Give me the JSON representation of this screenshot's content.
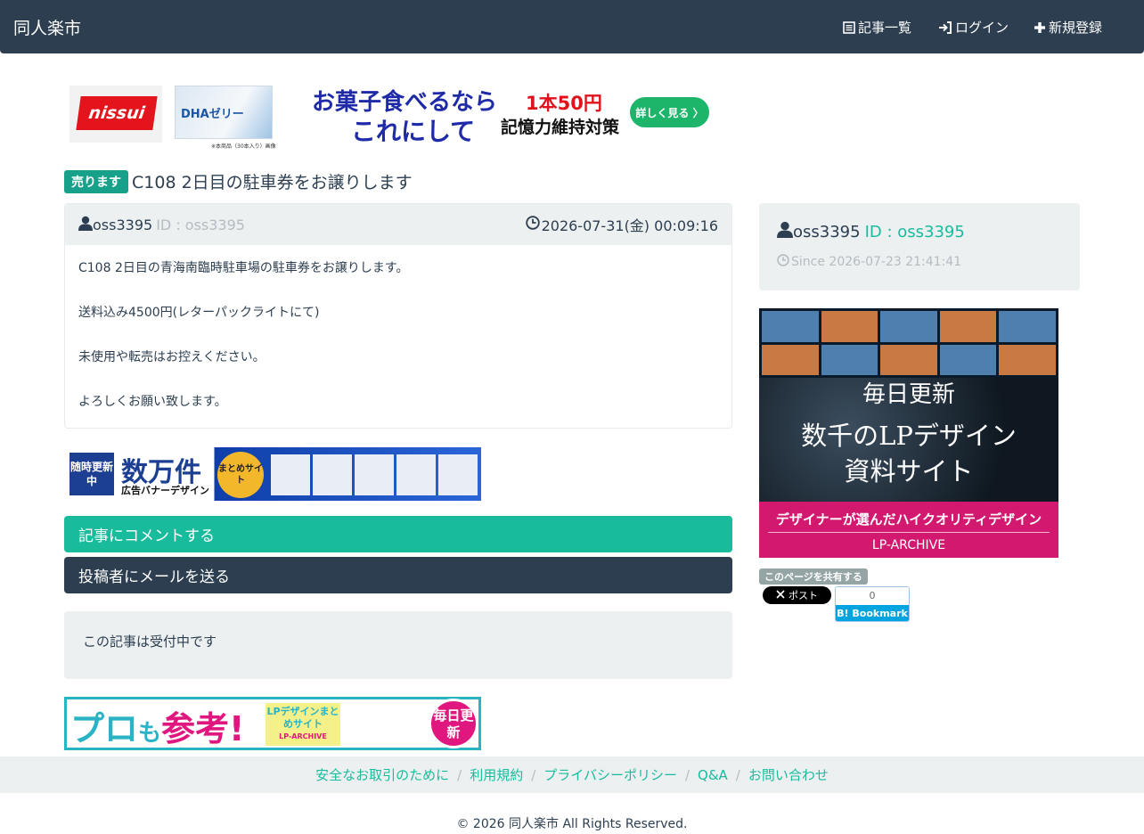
{
  "navbar": {
    "brand": "同人楽市",
    "items": [
      {
        "label": "記事一覧",
        "icon": "list-icon"
      },
      {
        "label": "ログイン",
        "icon": "login-icon"
      },
      {
        "label": "新規登録",
        "icon": "plus-icon"
      }
    ]
  },
  "ad_top": {
    "brand": "nissui",
    "product": "DHAゼリー",
    "note": "※本商品（30本入り）画像",
    "copy1": "お菓子食べるなら",
    "copy2": "これにして",
    "price": "1本50円",
    "sub": "記憶力維持対策",
    "button": "詳しく見る 〉"
  },
  "post": {
    "badge": "売ります",
    "title": "C108 2日目の駐車券をお譲りします",
    "author": "oss3395",
    "author_id": "ID : oss3395",
    "date": "2026-07-31(金) 00:09:16",
    "body": [
      "C108 2日目の青海南臨時駐車場の駐車券をお譲りします。",
      "送料込み4500円(レターパックライトにて)",
      "未使用や転売はお控えください。",
      "よろしくお願い致します。"
    ]
  },
  "ad_mid": {
    "tag": "随時更新中",
    "big": "数万件",
    "small": "広告バナーデザイン",
    "circle": "まとめサイト"
  },
  "actions": {
    "comment": "記事にコメントする",
    "mail": "投稿者にメールを送る"
  },
  "status": "この記事は受付中です",
  "ad_bottom": {
    "pro1": "プロ",
    "pro2": "も",
    "pro3": "参考!",
    "lp": "LPデザインまとめサイト",
    "lp_sub": "LP-ARCHIVE",
    "day": "毎日更新"
  },
  "user_card": {
    "name": "oss3395",
    "id": "ID : oss3395",
    "since": "Since 2026-07-23 21:41:41"
  },
  "side_ad": {
    "line1": "毎日更新",
    "line2a": "数千のLPデザイン",
    "line2b": "資料サイト",
    "pink1": "デザイナーが選んだハイクオリティデザイン",
    "pink2": "LP-ARCHIVE"
  },
  "share": {
    "label": "このページを共有する",
    "x_button": "ポスト",
    "hatena_count": "0",
    "hatena_button": "B! Bookmark"
  },
  "footer": {
    "links": [
      "安全なお取引のために",
      "利用規約",
      "プライバシーポリシー",
      "Q&A",
      "お問い合わせ"
    ],
    "copyright": "© 2026 同人楽市 All Rights Reserved."
  },
  "colors": {
    "navbar": "#2c3e50",
    "accent": "#18bc9c",
    "muted": "#b4bcc2",
    "panel": "#ecf0f1"
  }
}
